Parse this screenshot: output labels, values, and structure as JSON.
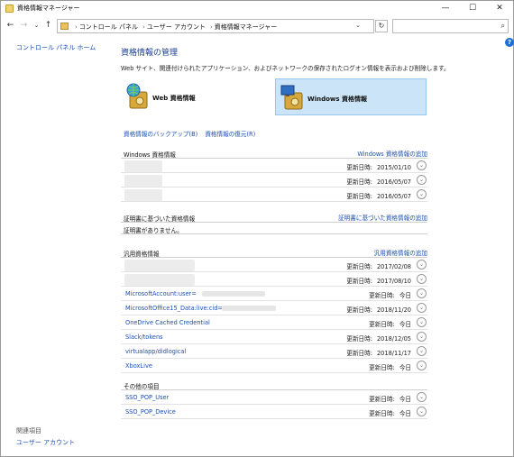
{
  "window": {
    "title": "資格情報マネージャー",
    "minimize": "—",
    "maximize": "☐",
    "close": "✕"
  },
  "nav": {
    "back": "←",
    "forward": "→",
    "recent": "⌄",
    "up": "↑",
    "refresh": "↻"
  },
  "address": {
    "crumbs": [
      "コントロール パネル",
      "ユーザー アカウント",
      "資格情報マネージャー"
    ],
    "separator": "›",
    "dropdown": "⌄"
  },
  "search": {
    "placeholder": "",
    "icon": "search-icon"
  },
  "left_pane": {
    "home_link": "コントロール パネル ホーム",
    "related_label": "関連項目",
    "user_accounts_link": "ユーザー アカウント"
  },
  "help": "?",
  "main": {
    "title": "資格情報の管理",
    "description": "Web サイト、関連付けられたアプリケーション、およびネットワークの保存されたログオン情報を表示および削除します。",
    "tabs": [
      {
        "label": "Web 資格情報",
        "icon": "globe-vault-icon",
        "selected": false
      },
      {
        "label": "Windows 資格情報",
        "icon": "monitor-vault-icon",
        "selected": true
      }
    ],
    "backup_link": "資格情報のバックアップ(B)",
    "restore_link": "資格情報の復元(R)"
  },
  "sections": {
    "windows": {
      "title": "Windows 資格情報",
      "add_link": "Windows 資格情報の追加",
      "rows": [
        {
          "name": "",
          "label": "更新日時:",
          "date": "2015/01/10"
        },
        {
          "name": "",
          "label": "更新日時:",
          "date": "2016/05/07"
        },
        {
          "name": "",
          "label": "更新日時:",
          "date": "2016/05/07"
        }
      ]
    },
    "certificate": {
      "title": "証明書に基づいた資格情報",
      "add_link": "証明書に基づいた資格情報の追加",
      "empty_text": "証明書がありません。"
    },
    "generic": {
      "title": "汎用資格情報",
      "add_link": "汎用資格情報の追加",
      "rows": [
        {
          "name": "",
          "label": "更新日時:",
          "date": "2017/02/08"
        },
        {
          "name": "",
          "label": "更新日時:",
          "date": "2017/08/10"
        },
        {
          "name": "MicrosoftAccount:user=",
          "label": "更新日時:",
          "date": "今日"
        },
        {
          "name": "MicrosoftOffice15_Data:live:cid=",
          "label": "更新日時:",
          "date": "2018/11/20"
        },
        {
          "name": "OneDrive Cached Credential",
          "label": "更新日時:",
          "date": "今日"
        },
        {
          "name": "Slack/tokens",
          "label": "更新日時:",
          "date": "2018/12/05"
        },
        {
          "name": "virtualapp/didlogical",
          "label": "更新日時:",
          "date": "2018/11/17"
        },
        {
          "name": "XboxLive",
          "label": "更新日時:",
          "date": "今日"
        }
      ]
    },
    "other": {
      "title": "その他の項目",
      "rows": [
        {
          "name": "SSO_POP_User",
          "label": "更新日時:",
          "date": "今日"
        },
        {
          "name": "SSO_POP_Device",
          "label": "更新日時:",
          "date": "今日"
        }
      ]
    }
  },
  "chevron": "⌄"
}
